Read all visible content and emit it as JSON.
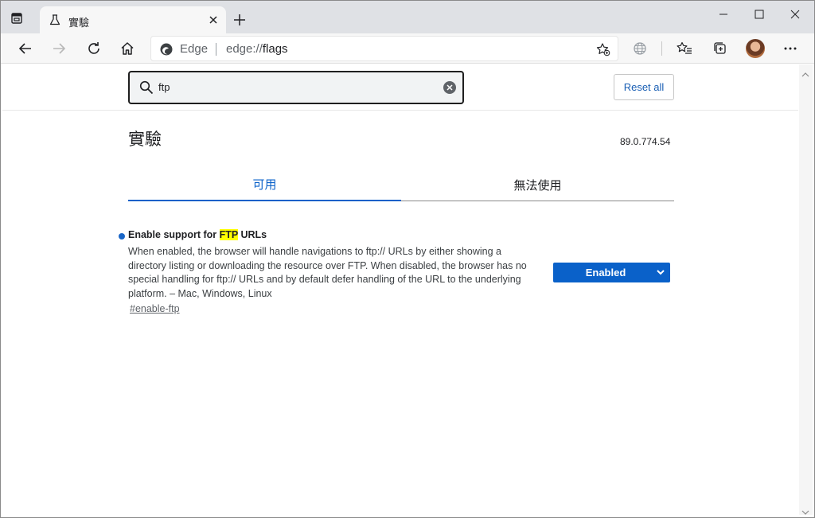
{
  "browser": {
    "tab": {
      "title": "實驗",
      "icon": "beaker-icon"
    },
    "address_bar": {
      "brand": "Edge",
      "url_prefix": "edge://",
      "url_path": "flags"
    },
    "icons": {
      "back": "back-arrow-icon",
      "forward": "forward-arrow-icon",
      "refresh": "refresh-icon",
      "home": "home-icon",
      "add_favorite": "add-favorite-icon",
      "translate": "globe-icon",
      "favorites": "favorites-icon",
      "collections": "collections-icon",
      "more": "more-icon"
    }
  },
  "flags": {
    "search": {
      "value": "ftp"
    },
    "reset_label": "Reset all",
    "title": "實驗",
    "version": "89.0.774.54",
    "tabs": [
      {
        "label": "可用",
        "active": true
      },
      {
        "label": "無法使用",
        "active": false
      }
    ],
    "experiments": [
      {
        "title_prefix": "Enable support for ",
        "title_highlight": "FTP",
        "title_suffix": " URLs",
        "description": "When enabled, the browser will handle navigations to ftp:// URLs by either showing a directory listing or downloading the resource over FTP. When disabled, the browser has no special handling for ftp:// URLs and by default defer handling of the URL to the underlying platform. – Mac, Windows, Linux",
        "link": "#enable-ftp",
        "state": "Enabled"
      }
    ]
  },
  "colors": {
    "accent": "#0a61c9",
    "highlight": "#ffff00",
    "tabbar": "#dfe1e5"
  }
}
